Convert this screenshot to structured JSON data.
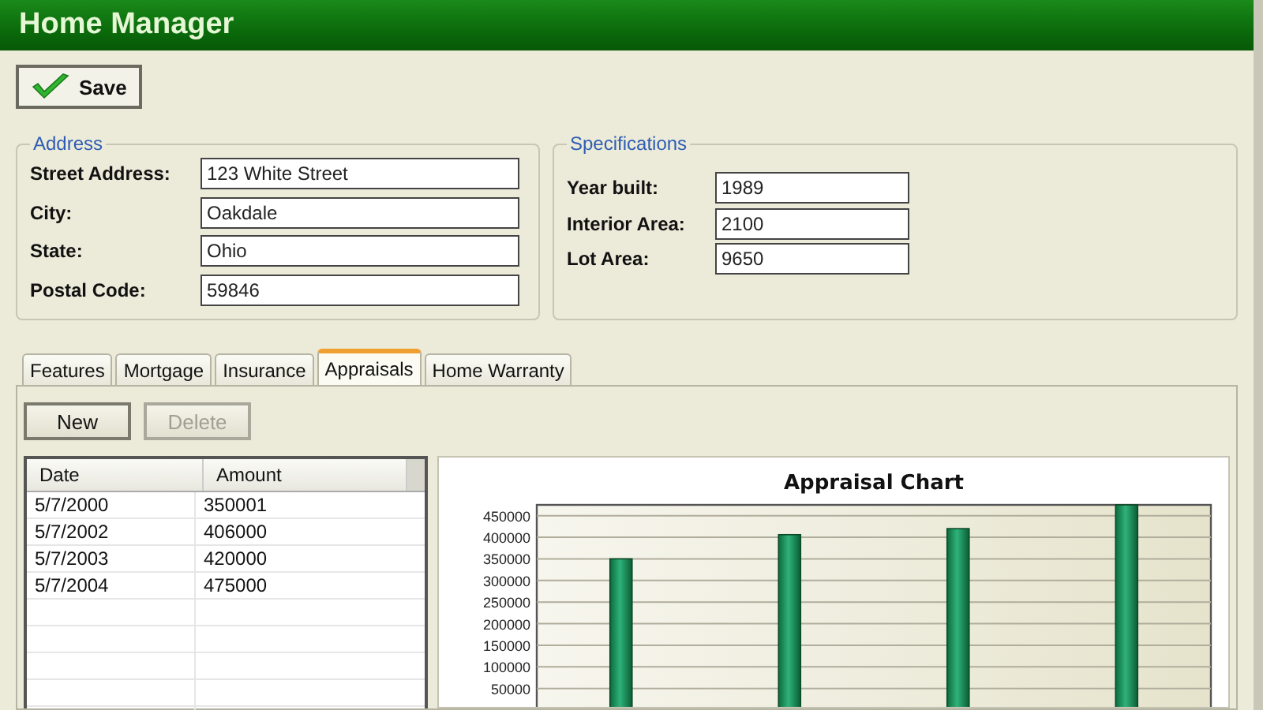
{
  "window": {
    "title": "Home Manager"
  },
  "toolbar": {
    "save_button": "Save"
  },
  "address": {
    "legend": "Address",
    "fields": [
      {
        "label": "Street Address:",
        "value": "123 White Street"
      },
      {
        "label": "City:",
        "value": "Oakdale"
      },
      {
        "label": "State:",
        "value": "Ohio"
      },
      {
        "label": "Postal Code:",
        "value": "59846"
      }
    ]
  },
  "specifications": {
    "legend": "Specifications",
    "fields": [
      {
        "label": "Year built:",
        "value": "1989"
      },
      {
        "label": "Interior Area:",
        "value": "2100"
      },
      {
        "label": "Lot Area:",
        "value": "9650"
      }
    ]
  },
  "tabs": [
    {
      "label": "Features",
      "selected": false
    },
    {
      "label": "Mortgage",
      "selected": false
    },
    {
      "label": "Insurance",
      "selected": false
    },
    {
      "label": "Appraisals",
      "selected": true
    },
    {
      "label": "Home Warranty",
      "selected": false
    }
  ],
  "tab_buttons": [
    {
      "label": "New",
      "disabled": false
    },
    {
      "label": "Delete",
      "disabled": true
    }
  ],
  "table": {
    "columns": [
      "Date",
      "Amount"
    ],
    "rows": [
      [
        "5/7/2000",
        "350001"
      ],
      [
        "5/7/2002",
        "406000"
      ],
      [
        "5/7/2003",
        "420000"
      ],
      [
        "5/7/2004",
        "475000"
      ]
    ]
  },
  "chart": {
    "chart_data": {
      "type": "bar",
      "title": "Appraisal Chart",
      "values": [
        350000,
        406000,
        420000,
        475000
      ],
      "grid": true,
      "ylim": [
        0,
        475000
      ],
      "yticks": [
        50000,
        100000,
        150000,
        200000,
        250000,
        300000,
        350000,
        400000,
        450000
      ]
    }
  }
}
